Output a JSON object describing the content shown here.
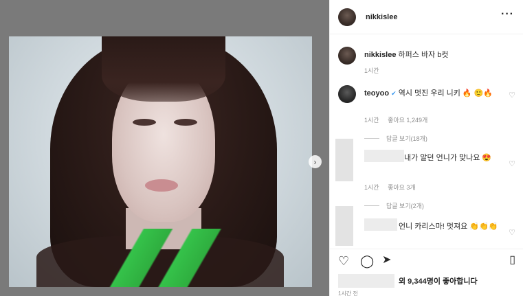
{
  "post": {
    "username": "nikkislee",
    "more_icon": "more-horizontal-icon",
    "caption": "하퍼스 바자 b컷",
    "caption_time": "1시간",
    "next_icon": "chevron-right-icon"
  },
  "comments": [
    {
      "username": "teoyoo",
      "text": "역시 멋진 우리 니키 🔥 🙂🔥",
      "time": "1시간",
      "likes": "좋아요 1,249개",
      "replies": "답글 보기(18개)"
    },
    {
      "username": "",
      "text": "내가 알던 언니가 맞나요 😍",
      "time": "1시간",
      "likes": "좋아요 3개",
      "replies": "답글 보기(2개)"
    },
    {
      "username": "",
      "text": "언니 카리스마! 멋져요 👏👏👏",
      "time": "",
      "likes": ""
    }
  ],
  "footer": {
    "likes_text": "외 9,344명이 좋아합니다",
    "time": "1시간 전",
    "icons": [
      "heart-icon",
      "comment-icon",
      "share-icon",
      "bookmark-icon"
    ]
  }
}
